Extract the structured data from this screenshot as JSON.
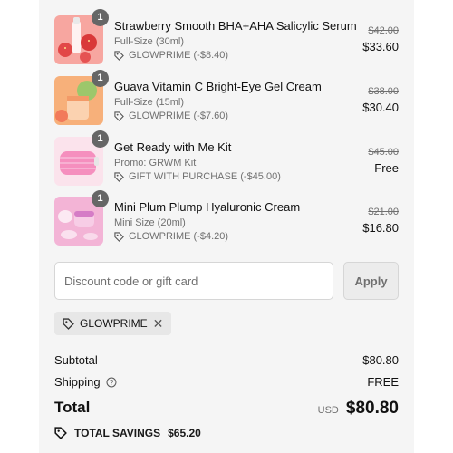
{
  "items": [
    {
      "quantity": "1",
      "name": "Strawberry Smooth BHA+AHA Salicylic Serum",
      "variant": "Full-Size (30ml)",
      "promo": "GLOWPRIME (-$8.40)",
      "original_price": "$42.00",
      "price": "$33.60",
      "thumb_colors": [
        "#f28b8b",
        "#e2504f"
      ],
      "promo_icon": "tag-icon"
    },
    {
      "quantity": "1",
      "name": "Guava Vitamin C Bright-Eye Gel Cream",
      "variant": "Full-Size (15ml)",
      "promo": "GLOWPRIME (-$7.60)",
      "original_price": "$38.00",
      "price": "$30.40",
      "thumb_colors": [
        "#f59a6a",
        "#f6c9a0"
      ],
      "promo_icon": "tag-icon"
    },
    {
      "quantity": "1",
      "name": "Get Ready with Me Kit",
      "variant": "Promo: GRWM Kit",
      "promo": "GIFT WITH PURCHASE (-$45.00)",
      "original_price": "$45.00",
      "price": "Free",
      "thumb_colors": [
        "#f6b9d3",
        "#ef7fb0"
      ],
      "promo_icon": "tag-icon"
    },
    {
      "quantity": "1",
      "name": "Mini Plum Plump Hyaluronic Cream",
      "variant": "Mini Size (20ml)",
      "promo": "GLOWPRIME (-$4.20)",
      "original_price": "$21.00",
      "price": "$16.80",
      "thumb_colors": [
        "#f4a9cf",
        "#d98ad9"
      ],
      "promo_icon": "tag-icon"
    }
  ],
  "discount": {
    "placeholder": "Discount code or gift card",
    "apply_label": "Apply",
    "applied_code": "GLOWPRIME",
    "remove_glyph": "✕"
  },
  "summary": {
    "subtotal_label": "Subtotal",
    "subtotal_value": "$80.80",
    "shipping_label": "Shipping",
    "shipping_value": "FREE",
    "total_label": "Total",
    "currency": "USD",
    "total_value": "$80.80",
    "savings_label": "TOTAL SAVINGS",
    "savings_value": "$65.20"
  },
  "colors": {
    "panel_bg": "#f5f5f5",
    "badge_bg": "#666666",
    "muted_text": "#707070"
  }
}
